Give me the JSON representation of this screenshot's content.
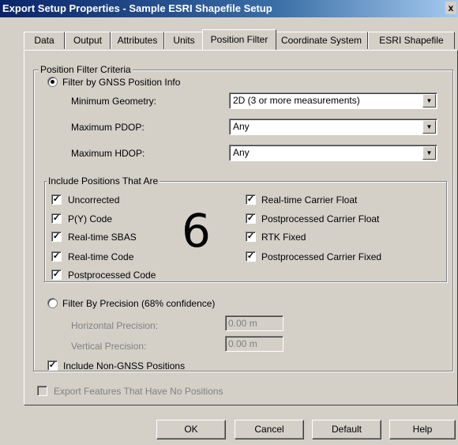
{
  "window": {
    "title": "Export Setup Properties - Sample ESRI Shapefile Setup",
    "close": "x"
  },
  "tabs": [
    "Data",
    "Output",
    "Attributes",
    "Units",
    "Position Filter",
    "Coordinate System",
    "ESRI Shapefile"
  ],
  "position_filter": {
    "group_label": "Position Filter Criteria",
    "filter_by_gnss": "Filter by GNSS Position Info",
    "min_geometry_label": "Minimum Geometry:",
    "min_geometry_value": "2D (3 or more measurements)",
    "max_pdop_label": "Maximum PDOP:",
    "max_pdop_value": "Any",
    "max_hdop_label": "Maximum HDOP:",
    "max_hdop_value": "Any"
  },
  "include": {
    "group_label": "Include Positions That Are",
    "left": [
      "Uncorrected",
      "P(Y) Code",
      "Real-time SBAS",
      "Real-time Code",
      "Postprocessed Code"
    ],
    "right": [
      "Real-time Carrier Float",
      "Postprocessed Carrier Float",
      "RTK Fixed",
      "Postprocessed Carrier Fixed"
    ]
  },
  "annotation": "6",
  "precision": {
    "filter_by_precision": "Filter By Precision (68% confidence)",
    "horizontal_label": "Horizontal Precision:",
    "horizontal_value": "0.00 m",
    "vertical_label": "Vertical Precision:",
    "vertical_value": "0.00 m"
  },
  "include_non_gnss": "Include Non-GNSS Positions",
  "export_no_positions": "Export Features That Have No Positions",
  "buttons": {
    "ok": "OK",
    "cancel": "Cancel",
    "default": "Default",
    "help": "Help"
  },
  "check": "✓"
}
